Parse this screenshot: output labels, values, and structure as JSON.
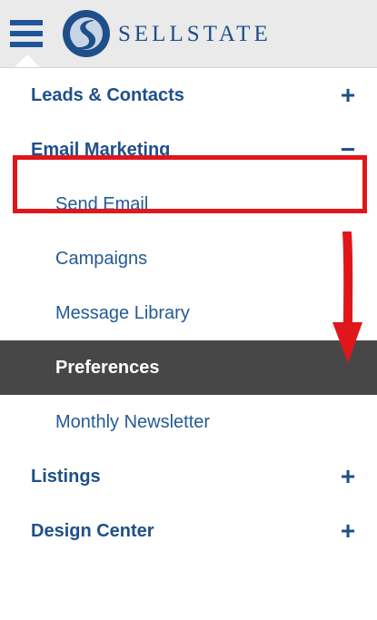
{
  "header": {
    "brand": "SELLSTATE",
    "menu_icon": "hamburger-icon",
    "logo_icon": "sellstate-logo",
    "brand_color": "#1f4f8a"
  },
  "menu": {
    "items": [
      {
        "label": "Leads & Contacts",
        "toggle": "+"
      },
      {
        "label": "Email Marketing",
        "toggle": "−"
      },
      {
        "label": "Send Email"
      },
      {
        "label": "Campaigns"
      },
      {
        "label": "Message Library"
      },
      {
        "label": "Preferences"
      },
      {
        "label": "Monthly Newsletter"
      },
      {
        "label": "Listings",
        "toggle": "+"
      },
      {
        "label": "Design Center",
        "toggle": "+"
      }
    ]
  },
  "colors": {
    "active_background": "#474747",
    "highlight": "#e0161b",
    "text": "#1f4f8a"
  }
}
